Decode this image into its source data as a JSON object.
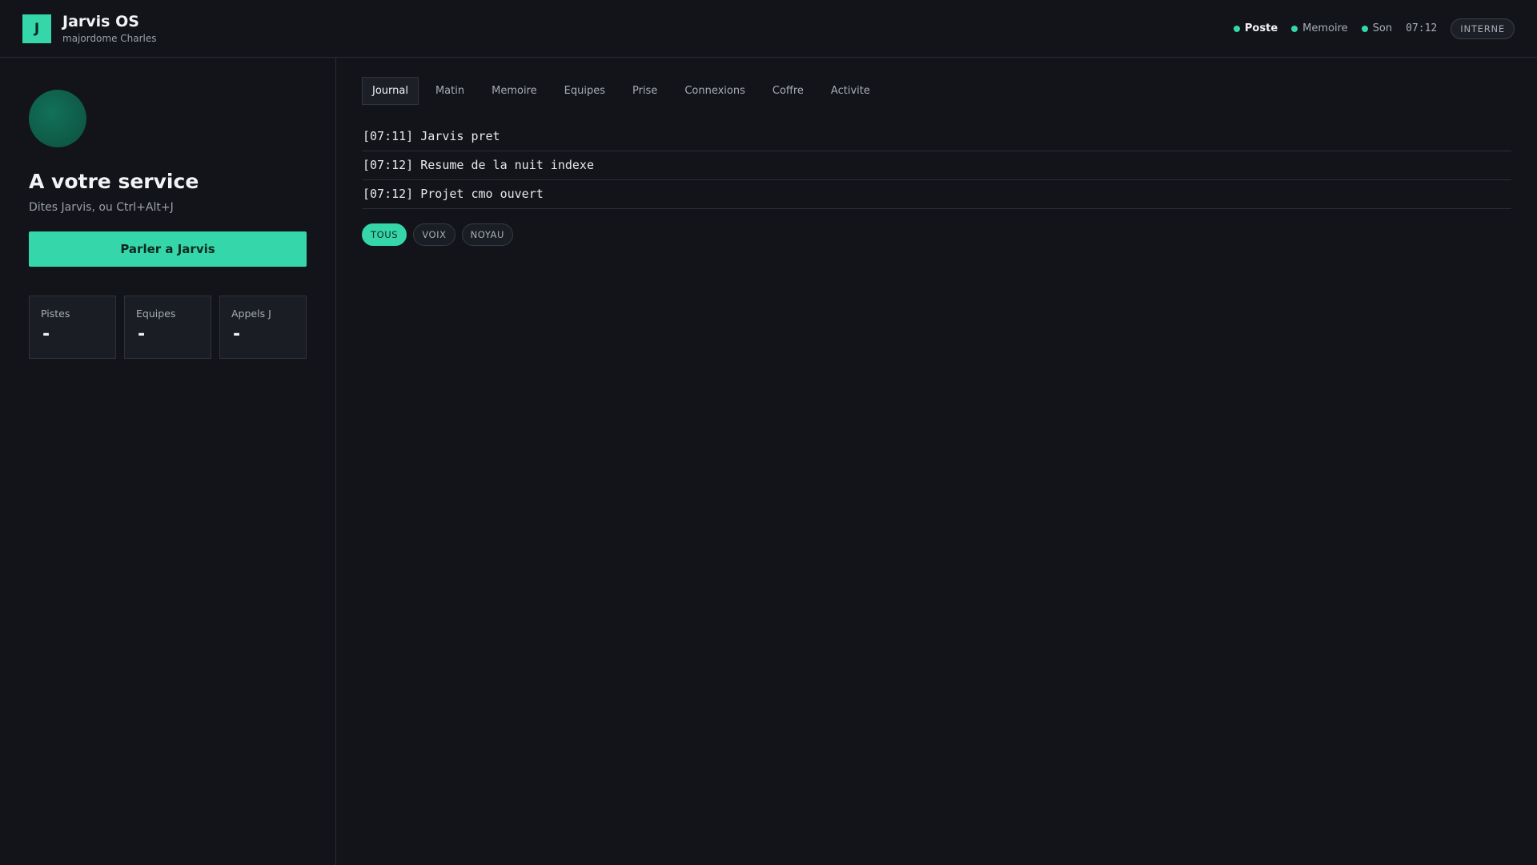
{
  "header": {
    "logo_letter": "J",
    "title": "Jarvis OS",
    "subtitle": "majordome Charles",
    "status": [
      {
        "label": "Poste",
        "active": true
      },
      {
        "label": "Memoire",
        "active": false
      },
      {
        "label": "Son",
        "active": false
      }
    ],
    "clock": "07:12",
    "badge": "INTERNE"
  },
  "sidebar": {
    "title": "A votre service",
    "subtitle": "Dites Jarvis, ou Ctrl+Alt+J",
    "talk_button": "Parler a Jarvis",
    "stats": [
      {
        "label": "Pistes",
        "value": "-"
      },
      {
        "label": "Equipes",
        "value": "-"
      },
      {
        "label": "Appels J",
        "value": "-"
      }
    ]
  },
  "main": {
    "tabs": [
      "Journal",
      "Matin",
      "Memoire",
      "Equipes",
      "Prise",
      "Connexions",
      "Coffre",
      "Activite"
    ],
    "active_tab": "Journal",
    "log": [
      "[07:11] Jarvis pret",
      "[07:12] Resume de la nuit indexe",
      "[07:12] Projet cmo ouvert"
    ],
    "filters": [
      "TOUS",
      "VOIX",
      "NOYAU"
    ],
    "active_filter": "TOUS"
  },
  "colors": {
    "accent": "#35d6a9",
    "background": "#121419",
    "panel": "#1a1d24"
  }
}
